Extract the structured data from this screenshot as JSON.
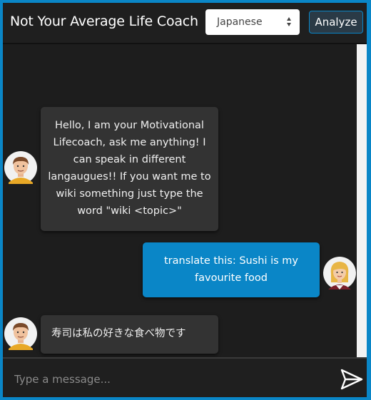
{
  "header": {
    "title": "Not Your Average Life Coach",
    "language_selected": "Japanese",
    "analyze_label": "Analyze"
  },
  "messages": [
    {
      "sender": "bot",
      "lines": [
        "Hello, I am your Motivational",
        "Lifecoach, ask me anything! I",
        "can speak in different",
        "langaugues!! If you want me to",
        "wiki something just type the",
        "word \"wiki <topic>\""
      ]
    },
    {
      "sender": "user",
      "lines": [
        "translate this: Sushi is my",
        "favourite food"
      ]
    },
    {
      "sender": "bot",
      "lines": [
        "寿司は私の好きな食べ物です"
      ]
    }
  ],
  "input": {
    "placeholder": "Type a message..."
  },
  "icons": {
    "bot_avatar": "male-avatar-icon",
    "user_avatar": "female-avatar-icon",
    "send": "send-icon"
  },
  "colors": {
    "accent": "#0a86c7",
    "background": "#1c1c1c",
    "bot_bubble": "#333333"
  }
}
